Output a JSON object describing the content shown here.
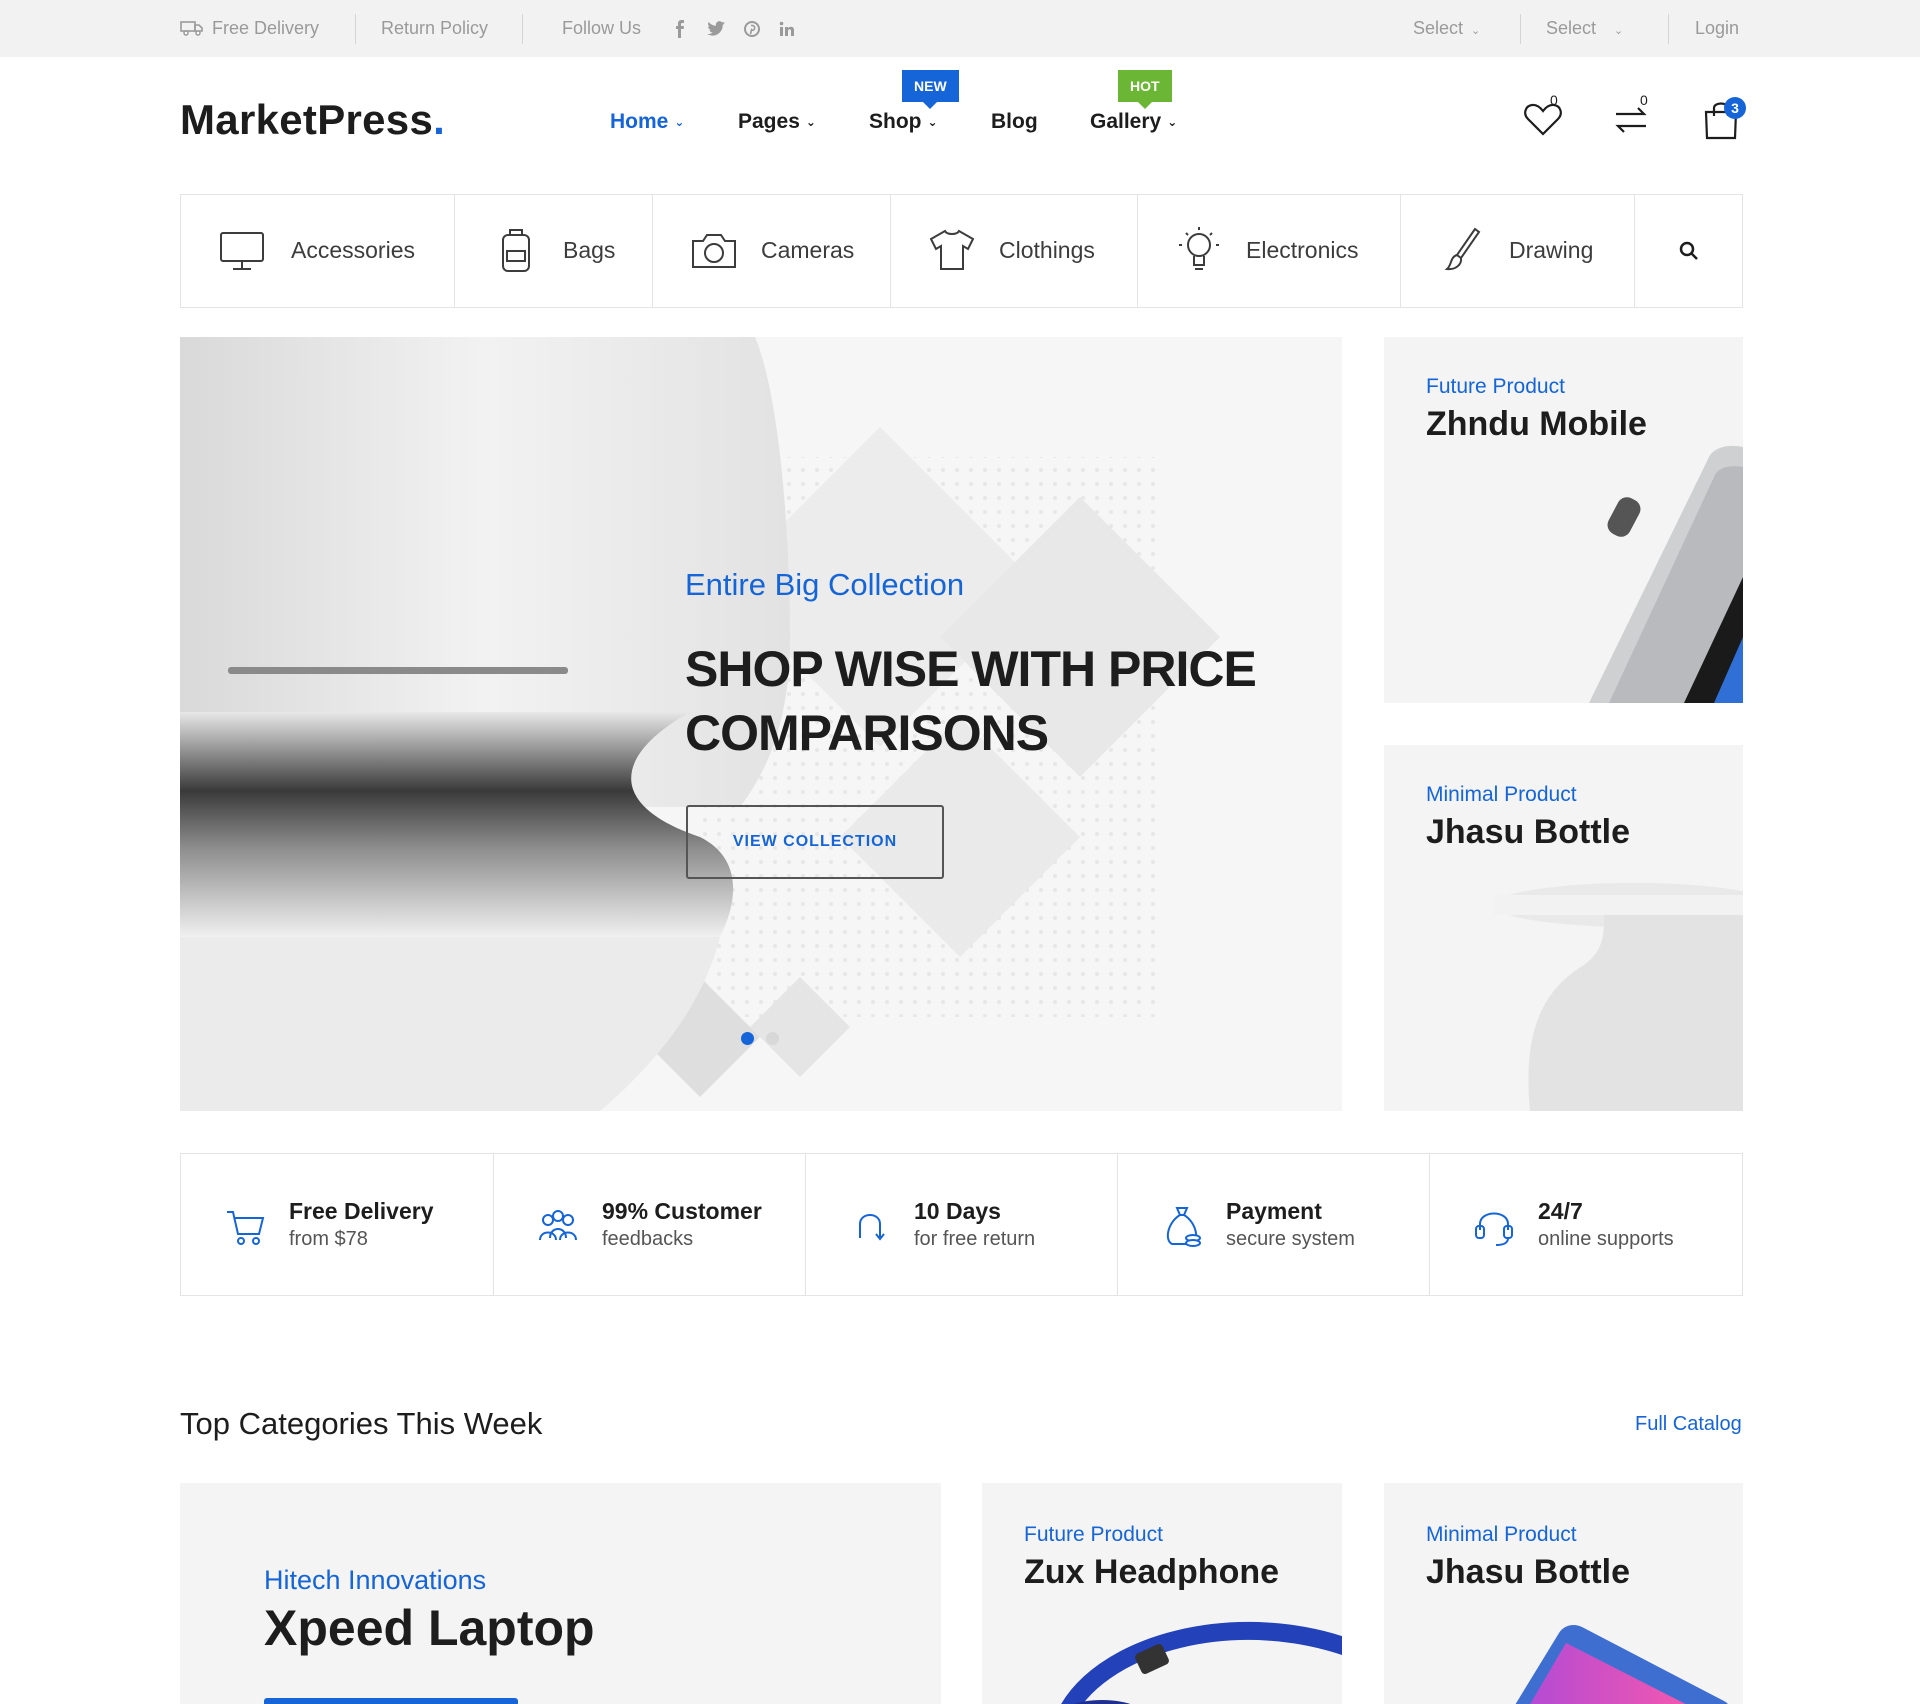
{
  "topbar": {
    "free_delivery": "Free Delivery",
    "return_policy": "Return Policy",
    "follow_us": "Follow Us",
    "social_icons": [
      "facebook-icon",
      "twitter-icon",
      "pinterest-icon",
      "linkedin-icon"
    ],
    "select_1": "Select",
    "select_2": "Select",
    "login": "Login"
  },
  "header": {
    "logo_text": "MarketPress",
    "logo_dot": ".",
    "nav": [
      {
        "label": "Home",
        "dropdown": true,
        "active": true
      },
      {
        "label": "Pages",
        "dropdown": true
      },
      {
        "label": "Shop",
        "dropdown": true,
        "badge": "NEW"
      },
      {
        "label": "Blog",
        "dropdown": false
      },
      {
        "label": "Gallery",
        "dropdown": true,
        "badge": "HOT"
      }
    ],
    "wishlist_count": "0",
    "compare_count": "0",
    "cart_count": "3"
  },
  "categories": [
    {
      "label": "Accessories",
      "icon": "monitor-icon"
    },
    {
      "label": "Bags",
      "icon": "backpack-icon"
    },
    {
      "label": "Cameras",
      "icon": "camera-icon"
    },
    {
      "label": "Clothings",
      "icon": "tshirt-icon"
    },
    {
      "label": "Electronics",
      "icon": "lightbulb-icon"
    },
    {
      "label": "Drawing",
      "icon": "brush-icon"
    }
  ],
  "hero": {
    "subtitle": "Entire Big Collection",
    "title": "SHOP WISE WITH PRICE COMPARISONS",
    "button": "VIEW COLLECTION",
    "slides_total": 2,
    "active_slide": 1
  },
  "side_promos": [
    {
      "subtitle": "Future Product",
      "title": "Zhndu Mobile"
    },
    {
      "subtitle": "Minimal Product",
      "title": "Jhasu Bottle"
    }
  ],
  "features": [
    {
      "title": "Free Delivery",
      "subtitle": "from $78",
      "icon": "cart-icon"
    },
    {
      "title": "99% Customer",
      "subtitle": "feedbacks",
      "icon": "customers-icon"
    },
    {
      "title": "10 Days",
      "subtitle": "for free return",
      "icon": "return-icon"
    },
    {
      "title": "Payment",
      "subtitle": "secure system",
      "icon": "money-bag-icon"
    },
    {
      "title": "24/7",
      "subtitle": "online supports",
      "icon": "headset-icon"
    }
  ],
  "top_categories": {
    "title": "Top Categories This Week",
    "link": "Full Catalog",
    "cards": [
      {
        "subtitle": "Hitech Innovations",
        "title": "Xpeed Laptop"
      },
      {
        "subtitle": "Future Product",
        "title": "Zux Headphone"
      },
      {
        "subtitle": "Minimal Product",
        "title": "Jhasu Bottle"
      }
    ]
  },
  "colors": {
    "accent": "#1565d8",
    "hot": "#6bb634",
    "topbar_bg": "#f2f2f2",
    "panel_bg": "#f4f4f4"
  }
}
